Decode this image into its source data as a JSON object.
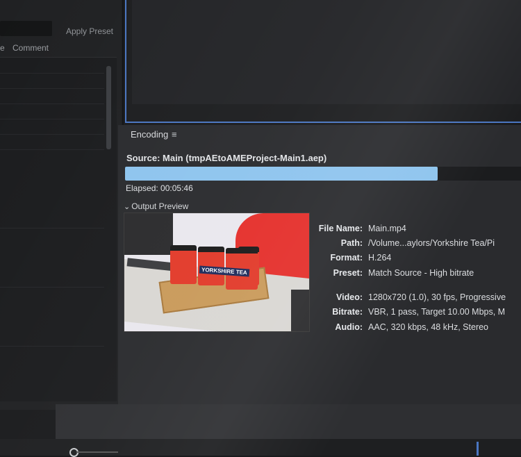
{
  "left_panel": {
    "apply_preset_label": "Apply Preset",
    "column_partial": "e",
    "column_comment": "Comment"
  },
  "encoding_panel": {
    "title": "Encoding",
    "menu_glyph": "≡",
    "source": "Source: Main (tmpAEtoAMEProject-Main1.aep)",
    "progress_fraction": 0.79,
    "elapsed": "Elapsed: 00:05:46",
    "preview_chevron": "⌄",
    "output_preview_label": "Output Preview",
    "thumbnail_label": "YORKSHIRE TEA",
    "info": [
      {
        "label": "File Name:",
        "value": "Main.mp4"
      },
      {
        "label": "Path:",
        "value": "/Volume...aylors/Yorkshire Tea/Pi"
      },
      {
        "label": "Format:",
        "value": "H.264"
      },
      {
        "label": "Preset:",
        "value": "Match Source - High bitrate"
      },
      {
        "label": "Video:",
        "value": "1280x720 (1.0), 30 fps, Progressive"
      },
      {
        "label": "Bitrate:",
        "value": "VBR, 1 pass, Target 10.00 Mbps, M"
      },
      {
        "label": "Audio:",
        "value": "AAC, 320 kbps, 48 kHz, Stereo"
      }
    ]
  },
  "colors": {
    "accent_blue": "#4a76c2",
    "progress_fill": "#8ec4ee",
    "panel_bg": "#2a2b2e"
  }
}
